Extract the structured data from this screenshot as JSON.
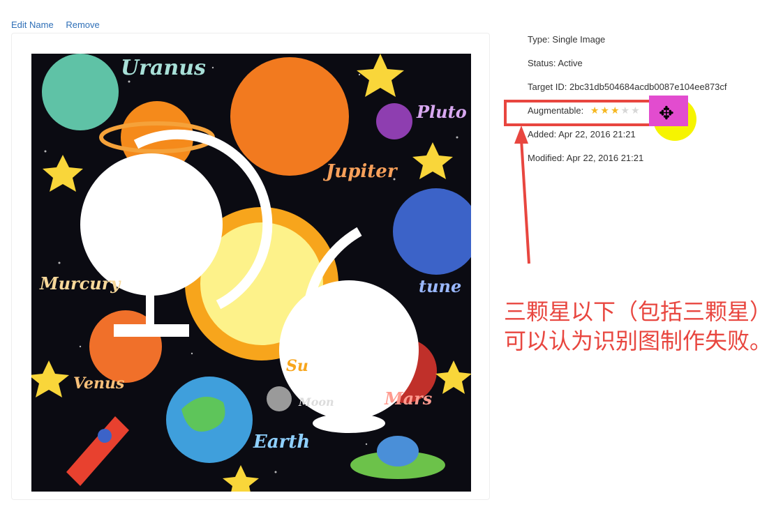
{
  "actions": {
    "edit_name": "Edit Name",
    "remove": "Remove"
  },
  "target": {
    "type": "Type: Single Image",
    "status": "Status: Active",
    "target_id": "Target ID: 2bc31db504684acdb0087e104ee873cf",
    "augmentable_label": "Augmentable:",
    "augmentable_rating": 3,
    "augmentable_max": 5,
    "added": "Added: Apr 22, 2016 21:21",
    "modified": "Modified: Apr 22, 2016 21:21"
  },
  "image_labels": {
    "uranus": "Uranus",
    "pluto": "Pluto",
    "jupiter": "Jupiter",
    "mercury": "Murcury",
    "neptune": "tune",
    "venus": "Venus",
    "earth": "Earth",
    "moon": "Moon",
    "mars": "Mars",
    "sun": "Su"
  },
  "annotation": {
    "text": "三颗星以下（包括三颗星）可以认为识别图制作失败。"
  },
  "colors": {
    "link": "#2e6fb7",
    "annotation_red": "#e8463f",
    "star_on": "#f5b822",
    "star_off": "#d7d7d7",
    "cursor_highlight": "#f6f400"
  }
}
